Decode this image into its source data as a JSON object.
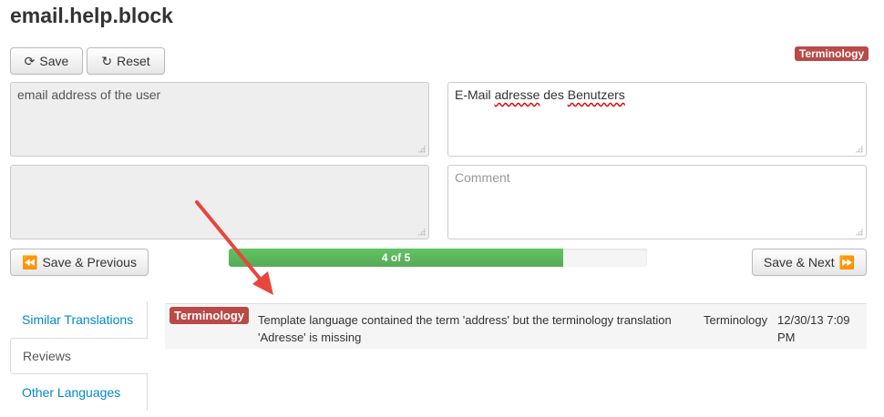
{
  "page": {
    "title": "email.help.block"
  },
  "toolbar": {
    "save_label": "Save",
    "reset_label": "Reset",
    "terminology_badge": "Terminology"
  },
  "source": {
    "text": "email address of the user",
    "comment": ""
  },
  "target": {
    "text_before": "E-Mail ",
    "text_misspelled": "adresse",
    "text_after": " des ",
    "text_misspelled2": "Benutzers",
    "comment_placeholder": "Comment"
  },
  "navigation": {
    "prev_label": "Save & Previous",
    "next_label": "Save & Next",
    "progress_label": "4 of 5",
    "progress_fraction": 0.8
  },
  "tabs": [
    {
      "label": "Similar Translations",
      "active": false
    },
    {
      "label": "Reviews",
      "active": true
    },
    {
      "label": "Other Languages",
      "active": false
    }
  ],
  "reviews": [
    {
      "badge": "Terminology",
      "message": "Template language contained the term 'address' but the terminology translation 'Adresse' is missing",
      "type": "Terminology",
      "date": "12/30/13 7:09 PM"
    }
  ],
  "colors": {
    "danger": "#b94a48",
    "success": "#5eb95e",
    "link": "#0088cc",
    "arrow": "#e8453c"
  }
}
